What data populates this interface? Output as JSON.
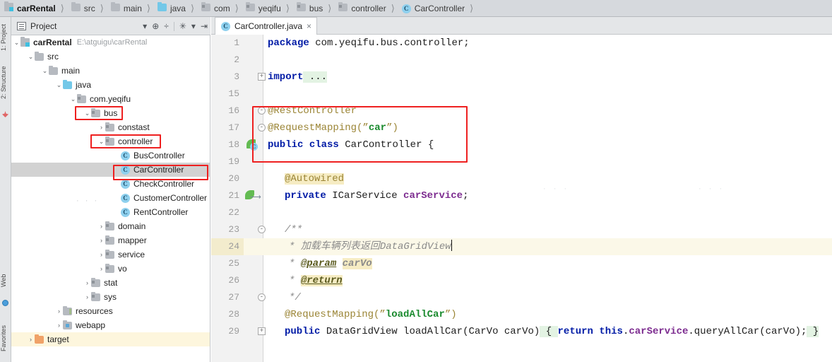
{
  "breadcrumb": {
    "items": [
      {
        "label": "carRental",
        "icon": "module-icon"
      },
      {
        "label": "src",
        "icon": "folder-icon"
      },
      {
        "label": "main",
        "icon": "folder-icon"
      },
      {
        "label": "java",
        "icon": "source-folder-icon"
      },
      {
        "label": "com",
        "icon": "package-icon"
      },
      {
        "label": "yeqifu",
        "icon": "package-icon"
      },
      {
        "label": "bus",
        "icon": "package-icon"
      },
      {
        "label": "controller",
        "icon": "package-icon"
      },
      {
        "label": "CarController",
        "icon": "class-icon"
      }
    ]
  },
  "tool_strip": {
    "tabs": [
      "1: Project",
      "2: Structure",
      "Web",
      "Favorites"
    ],
    "icons": [
      "pin-icon",
      "globe-icon"
    ]
  },
  "project_panel": {
    "title": "Project",
    "toolbar": [
      {
        "name": "view-mode-dropdown",
        "glyph": "▾"
      },
      {
        "name": "locate-target-icon",
        "glyph": "⊕"
      },
      {
        "name": "collapse-all-icon",
        "glyph": "÷"
      },
      {
        "name": "settings-gear-icon",
        "glyph": "✳"
      },
      {
        "name": "gear-dropdown-icon",
        "glyph": "▾"
      },
      {
        "name": "hide-panel-icon",
        "glyph": "⇥"
      }
    ],
    "tree": [
      {
        "label": "carRental",
        "path": "E:\\atguigu\\carRental",
        "indent": 0,
        "arrow": "⌄",
        "icon": "module-icon",
        "bold": true,
        "state": "normal"
      },
      {
        "label": "src",
        "path": "",
        "indent": 1,
        "arrow": "⌄",
        "icon": "folder-icon",
        "bold": false,
        "state": "normal"
      },
      {
        "label": "main",
        "path": "",
        "indent": 2,
        "arrow": "⌄",
        "icon": "folder-icon",
        "bold": false,
        "state": "normal"
      },
      {
        "label": "java",
        "path": "",
        "indent": 3,
        "arrow": "⌄",
        "icon": "source-folder-icon",
        "bold": false,
        "state": "normal"
      },
      {
        "label": "com.yeqifu",
        "path": "",
        "indent": 4,
        "arrow": "⌄",
        "icon": "package-icon",
        "bold": false,
        "state": "normal"
      },
      {
        "label": "bus",
        "path": "",
        "indent": 5,
        "arrow": "⌄",
        "icon": "package-icon",
        "bold": false,
        "state": "normal"
      },
      {
        "label": "constast",
        "path": "",
        "indent": 6,
        "arrow": "›",
        "icon": "package-icon",
        "bold": false,
        "state": "normal"
      },
      {
        "label": "controller",
        "path": "",
        "indent": 6,
        "arrow": "⌄",
        "icon": "package-icon",
        "bold": false,
        "state": "normal"
      },
      {
        "label": "BusController",
        "path": "",
        "indent": 7,
        "arrow": "",
        "icon": "class-icon",
        "bold": false,
        "state": "normal"
      },
      {
        "label": "CarController",
        "path": "",
        "indent": 7,
        "arrow": "",
        "icon": "class-icon",
        "bold": false,
        "state": "selected"
      },
      {
        "label": "CheckController",
        "path": "",
        "indent": 7,
        "arrow": "",
        "icon": "class-icon",
        "bold": false,
        "state": "normal"
      },
      {
        "label": "CustomerController",
        "path": "",
        "indent": 7,
        "arrow": "",
        "icon": "class-icon",
        "bold": false,
        "state": "normal"
      },
      {
        "label": "RentController",
        "path": "",
        "indent": 7,
        "arrow": "",
        "icon": "class-icon",
        "bold": false,
        "state": "normal"
      },
      {
        "label": "domain",
        "path": "",
        "indent": 6,
        "arrow": "›",
        "icon": "package-icon",
        "bold": false,
        "state": "normal"
      },
      {
        "label": "mapper",
        "path": "",
        "indent": 6,
        "arrow": "›",
        "icon": "package-icon",
        "bold": false,
        "state": "normal"
      },
      {
        "label": "service",
        "path": "",
        "indent": 6,
        "arrow": "›",
        "icon": "package-icon",
        "bold": false,
        "state": "normal"
      },
      {
        "label": "vo",
        "path": "",
        "indent": 6,
        "arrow": "›",
        "icon": "package-icon",
        "bold": false,
        "state": "normal"
      },
      {
        "label": "stat",
        "path": "",
        "indent": 5,
        "arrow": "›",
        "icon": "package-icon",
        "bold": false,
        "state": "normal"
      },
      {
        "label": "sys",
        "path": "",
        "indent": 5,
        "arrow": "›",
        "icon": "package-icon",
        "bold": false,
        "state": "normal"
      },
      {
        "label": "resources",
        "path": "",
        "indent": 4,
        "arrow": "›",
        "icon": "resources-folder-icon",
        "bold": false,
        "state": "normal"
      },
      {
        "label": "webapp",
        "path": "",
        "indent": 4,
        "arrow": "›",
        "icon": "webapp-folder-icon",
        "bold": false,
        "state": "normal"
      },
      {
        "label": "target",
        "path": "",
        "indent": 2,
        "arrow": "›",
        "icon": "target-folder-icon",
        "bold": false,
        "state": "highlighted"
      }
    ]
  },
  "editor": {
    "tab": {
      "label": "CarController.java",
      "icon": "class-icon",
      "close": "×"
    },
    "lines": [
      {
        "num": "1",
        "fold": "",
        "gutter_icon": "",
        "highlight": false
      },
      {
        "num": "2",
        "fold": "",
        "gutter_icon": "",
        "highlight": false
      },
      {
        "num": "3",
        "fold": "+",
        "gutter_icon": "",
        "highlight": false
      },
      {
        "num": "15",
        "fold": "",
        "gutter_icon": "",
        "highlight": false
      },
      {
        "num": "16",
        "fold": "-",
        "gutter_icon": "",
        "highlight": false
      },
      {
        "num": "17",
        "fold": "-",
        "gutter_icon": "",
        "highlight": false
      },
      {
        "num": "18",
        "fold": "",
        "gutter_icon": "spring-bean-icon",
        "highlight": false
      },
      {
        "num": "19",
        "fold": "",
        "gutter_icon": "",
        "highlight": false
      },
      {
        "num": "20",
        "fold": "",
        "gutter_icon": "",
        "highlight": false
      },
      {
        "num": "21",
        "fold": "",
        "gutter_icon": "spring-autowired-icon",
        "highlight": false
      },
      {
        "num": "22",
        "fold": "",
        "gutter_icon": "",
        "highlight": false
      },
      {
        "num": "23",
        "fold": "-",
        "gutter_icon": "",
        "highlight": false
      },
      {
        "num": "24",
        "fold": "",
        "gutter_icon": "",
        "highlight": true
      },
      {
        "num": "25",
        "fold": "",
        "gutter_icon": "",
        "highlight": false
      },
      {
        "num": "26",
        "fold": "",
        "gutter_icon": "",
        "highlight": false
      },
      {
        "num": "27",
        "fold": "-",
        "gutter_icon": "",
        "highlight": false
      },
      {
        "num": "28",
        "fold": "",
        "gutter_icon": "",
        "highlight": false
      },
      {
        "num": "29",
        "fold": "+",
        "gutter_icon": "",
        "highlight": false
      }
    ],
    "code": {
      "l1_kw": "package",
      "l1_rest": " com.yeqifu.bus.controller;",
      "l3_kw": "import",
      "l3_rest": " ...",
      "l16": "@RestController",
      "l17_ann": "@RequestMapping",
      "l17_open": "(”",
      "l17_str": "car",
      "l17_close": "”)",
      "l18_kw1": "public",
      "l18_kw2": "class",
      "l18_name": "CarController",
      "l18_brace": "{",
      "l20": "@Autowired",
      "l21_kw": "private",
      "l21_type": "ICarService",
      "l21_field": "carService",
      "l21_semi": ";",
      "l23": "/**",
      "l24_star": "* ",
      "l24_text": "加载车辆列表返回",
      "l24_code": "DataGridView",
      "l25_star": "* ",
      "l25_tag": "@param",
      "l25_val": "carVo",
      "l26_star": "* ",
      "l26_tag": "@return",
      "l27": "*/",
      "l28_ann": "@RequestMapping",
      "l28_open": "(”",
      "l28_str": "loadAllCar",
      "l28_close": "”)",
      "l29_kw1": "public",
      "l29_type": "DataGridView",
      "l29_method": " loadAllCar(CarVo carVo)",
      "l29_brace1": " { ",
      "l29_kw2": "return",
      "l29_this": "this",
      "l29_dot1": ".",
      "l29_field": "carService",
      "l29_call": ".queryAllCar(carVo);",
      "l29_brace2": " }"
    }
  },
  "annotations": {
    "color": "#ee2020",
    "boxes": [
      "bus-tree-node",
      "controller-tree-node",
      "carcontroller-tree-node",
      "class-declaration-block"
    ]
  }
}
